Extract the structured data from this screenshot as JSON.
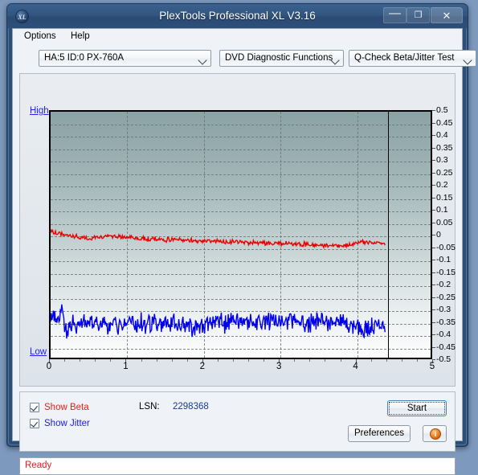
{
  "window": {
    "title": "PlexTools Professional XL V3.16",
    "icon_text": "XL",
    "minimize_glyph": "—",
    "maximize_glyph": "❐",
    "close_glyph": "✕"
  },
  "menu": {
    "options": "Options",
    "help": "Help"
  },
  "toolbar": {
    "drive_combo": "HA:5 ID:0  PX-760A",
    "function_combo": "DVD Diagnostic Functions",
    "test_combo": "Q-Check Beta/Jitter Test"
  },
  "controls": {
    "show_beta": "Show Beta",
    "show_jitter": "Show Jitter",
    "show_beta_checked": true,
    "show_jitter_checked": true,
    "lsn_label": "LSN:",
    "lsn_value": "2298368",
    "start_button": "Start",
    "preferences_button": "Preferences",
    "info_button": "i"
  },
  "status": {
    "text": "Ready"
  },
  "colors": {
    "beta_trace": "#ee0000",
    "jitter_trace": "#0000ee",
    "high_low_label": "#2222ee",
    "status": "#e02020",
    "lsn_value": "#1a3a8f"
  },
  "chart_data": {
    "type": "line",
    "title": "Q-Check Beta/Jitter Test",
    "xlabel": "",
    "ylabel": "",
    "axis_high_label": "High",
    "axis_low_label": "Low",
    "xlim": [
      0,
      5
    ],
    "ylim": [
      -0.5,
      0.5
    ],
    "xticks": [
      0,
      1,
      2,
      3,
      4,
      5
    ],
    "xtick_labels": [
      "0",
      "1",
      "2",
      "3",
      "4",
      "5"
    ],
    "yticks": [
      0.5,
      0.45,
      0.4,
      0.35,
      0.3,
      0.25,
      0.2,
      0.15,
      0.1,
      0.05,
      0,
      -0.05,
      -0.1,
      -0.15,
      -0.2,
      -0.25,
      -0.3,
      -0.35,
      -0.4,
      -0.45,
      -0.5
    ],
    "ytick_labels": [
      "0.5",
      "0.45",
      "0.4",
      "0.35",
      "0.3",
      "0.25",
      "0.2",
      "0.15",
      "0.1",
      "0.05",
      "0",
      "-0.05",
      "-0.1",
      "-0.15",
      "-0.2",
      "-0.25",
      "-0.3",
      "-0.35",
      "-0.4",
      "-0.45",
      "-0.5"
    ],
    "grid": true,
    "data_end_marker_x": 4.4,
    "series": [
      {
        "name": "Beta",
        "color": "#ee0000",
        "noise": 0.007,
        "x": [
          0.0,
          0.08,
          0.16,
          0.24,
          0.32,
          0.4,
          0.5,
          0.6,
          0.7,
          0.8,
          0.9,
          1.0,
          1.2,
          1.4,
          1.6,
          1.8,
          2.0,
          2.2,
          2.4,
          2.6,
          2.8,
          3.0,
          3.2,
          3.4,
          3.6,
          3.8,
          3.95,
          4.05,
          4.15,
          4.25,
          4.35,
          4.4
        ],
        "y": [
          0.013,
          0.007,
          0.002,
          -0.002,
          -0.008,
          -0.012,
          -0.018,
          -0.01,
          -0.008,
          -0.008,
          -0.009,
          -0.011,
          -0.016,
          -0.019,
          -0.021,
          -0.023,
          -0.025,
          -0.027,
          -0.029,
          -0.031,
          -0.033,
          -0.035,
          -0.037,
          -0.04,
          -0.042,
          -0.044,
          -0.045,
          -0.03,
          -0.028,
          -0.034,
          -0.035,
          -0.035
        ]
      },
      {
        "name": "Jitter",
        "color": "#0000ee",
        "noise": 0.03,
        "x": [
          0.0,
          0.05,
          0.1,
          0.14,
          0.18,
          0.22,
          0.3,
          0.4,
          0.5,
          0.7,
          0.9,
          1.1,
          1.3,
          1.5,
          1.7,
          1.9,
          2.1,
          2.3,
          2.5,
          2.7,
          2.9,
          3.1,
          3.3,
          3.5,
          3.7,
          3.9,
          4.0,
          4.1,
          4.2,
          4.3,
          4.38,
          4.4
        ],
        "y": [
          -0.335,
          -0.325,
          -0.355,
          -0.3,
          -0.37,
          -0.385,
          -0.365,
          -0.36,
          -0.362,
          -0.368,
          -0.366,
          -0.362,
          -0.364,
          -0.36,
          -0.368,
          -0.372,
          -0.366,
          -0.36,
          -0.358,
          -0.356,
          -0.354,
          -0.352,
          -0.356,
          -0.354,
          -0.352,
          -0.358,
          -0.37,
          -0.392,
          -0.38,
          -0.372,
          -0.376,
          -0.378
        ]
      }
    ]
  }
}
